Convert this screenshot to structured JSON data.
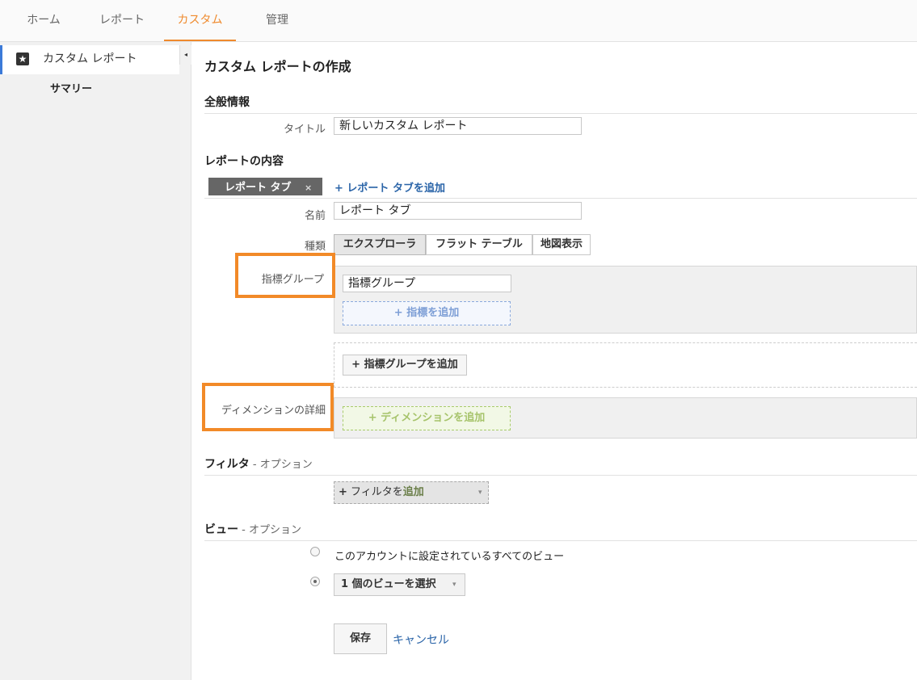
{
  "topnav": {
    "tabs": [
      {
        "label": "ホーム"
      },
      {
        "label": "レポート"
      },
      {
        "label": "カスタム"
      },
      {
        "label": "管理"
      }
    ],
    "active": "カスタム",
    "accent": "#ef8a2d"
  },
  "sidebar": {
    "item_label": "カスタム レポート",
    "sub_label": "サマリー",
    "icon": "star-icon",
    "collapse_icon": "◂"
  },
  "page": {
    "title": "カスタム レポートの作成"
  },
  "general": {
    "section_title": "全般情報",
    "title_label": "タイトル",
    "title_value": "新しいカスタム レポート"
  },
  "content": {
    "section_title": "レポートの内容",
    "tab_chip": "レポート タブ",
    "tab_chip_close": "×",
    "add_tab_link": "+ レポート タブを追加",
    "name_label": "名前",
    "name_value": "レポート タブ",
    "type_label": "種類",
    "types": [
      "エクスプローラ",
      "フラット テーブル",
      "地図表示"
    ],
    "metric_group_label": "指標グループ",
    "metric_group_value": "指標グループ",
    "add_metric": "+ 指標を追加",
    "add_metric_group": "+ 指標グループを追加",
    "dimension_label": "ディメンションの詳細",
    "add_dimension": "+ ディメンションを追加"
  },
  "filter": {
    "section_title": "フィルタ",
    "optional": " - オプション",
    "add_filter_plus": "+",
    "add_filter_text": " フィルタを",
    "add_filter_bold": "追加"
  },
  "view": {
    "section_title": "ビュー",
    "optional": " - オプション",
    "option_all": "このアカウントに設定されているすべてのビュー",
    "option_select": "1 個のビューを選択",
    "selected": "option_select"
  },
  "actions": {
    "save": "保存",
    "cancel": "キャンセル"
  },
  "colors": {
    "highlight": "#f28a28",
    "link": "#2a64a8",
    "sidebar_active_border": "#3c7ad8"
  }
}
